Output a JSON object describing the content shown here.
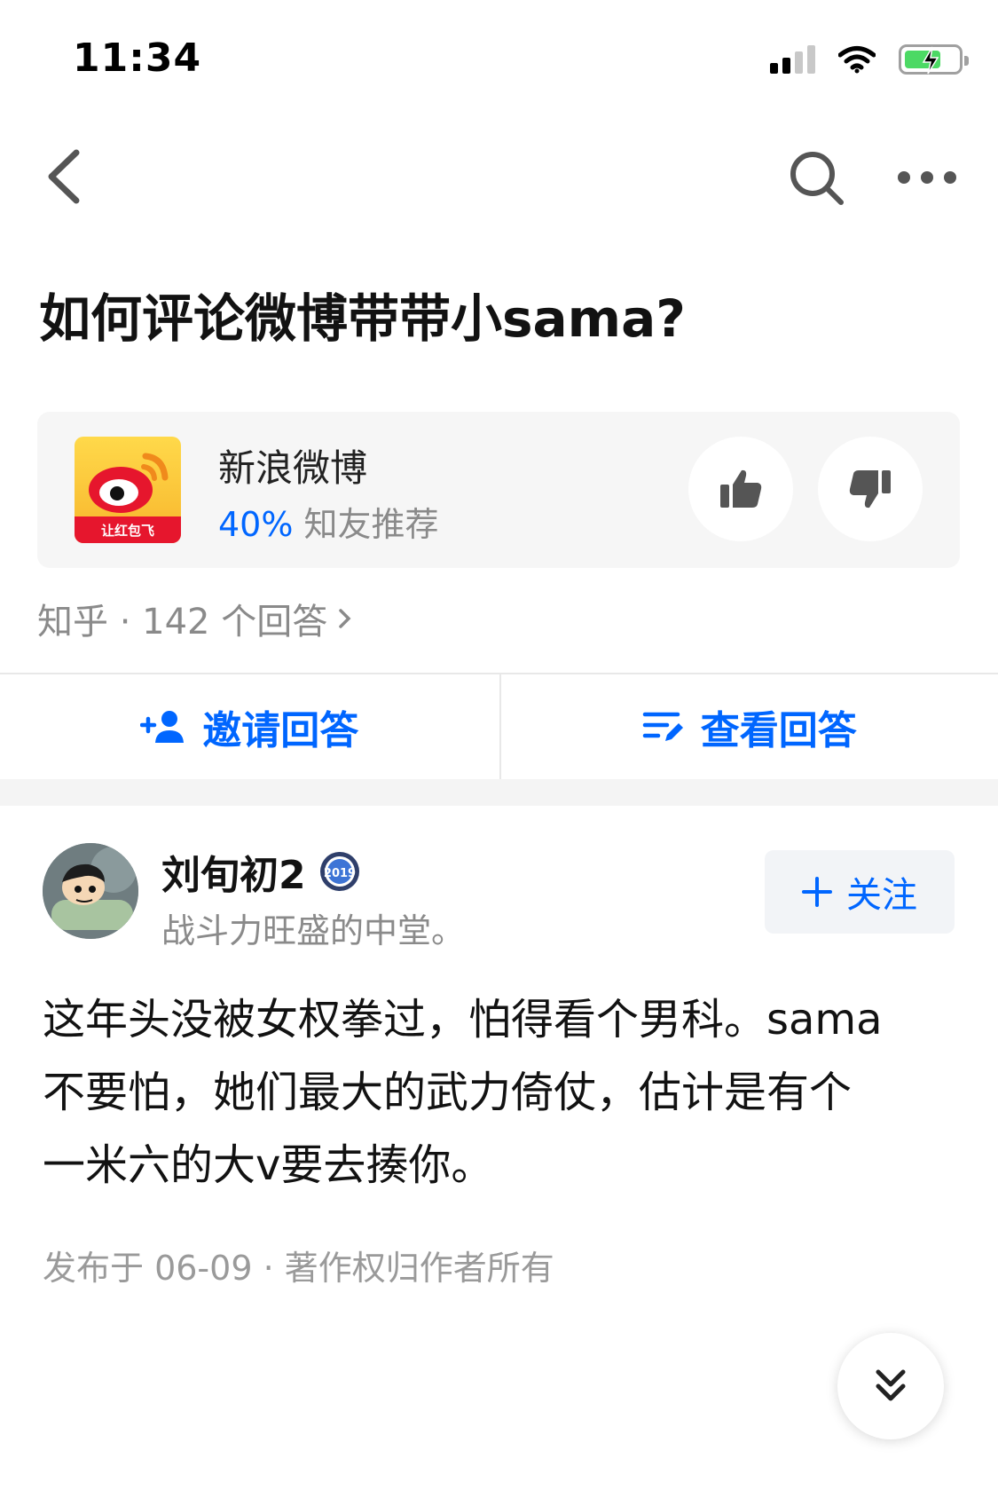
{
  "status_bar": {
    "time": "11:34"
  },
  "question": {
    "title": "如何评论微博带带小sama?"
  },
  "topic": {
    "name": "新浪微博",
    "percent": "40%",
    "recommend_text": "知友推荐",
    "logo_caption": "让红包飞"
  },
  "meta": {
    "text": "知乎 · 142 个回答"
  },
  "actions": {
    "invite": "邀请回答",
    "view": "查看回答"
  },
  "answer": {
    "author": "刘旬初2",
    "badge_year": "2019",
    "bio": "战斗力旺盛的中堂。",
    "follow_label": "关注",
    "body_lines": [
      "这年头没被女权拳过，怕得看个男科。sama",
      "不要怕，她们最大的武力倚仗，估计是有个",
      "一米六的大v要去揍你。"
    ],
    "footer": "发布于 06-09 · 著作权归作者所有"
  },
  "colors": {
    "accent": "#0066ff",
    "text_secondary": "#8a8a8a"
  }
}
